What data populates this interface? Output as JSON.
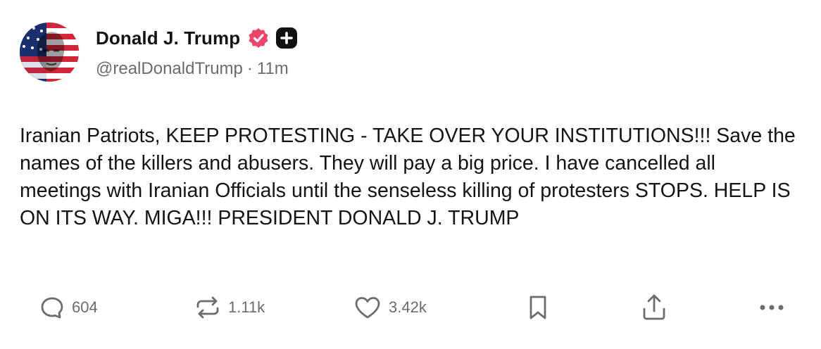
{
  "author": {
    "display_name": "Donald J. Trump",
    "handle": "@realDonaldTrump",
    "separator": "·",
    "time_ago": "11m",
    "avatar_alt": "Donald J. Trump profile photo",
    "verified_icon": "verified-badge-icon",
    "verified_color": "#f0436a",
    "plus_icon": "plus-badge-icon"
  },
  "post": {
    "text": "Iranian Patriots, KEEP PROTESTING - TAKE OVER YOUR INSTITUTIONS!!! Save the names of the killers and abusers. They will pay a big price. I have cancelled all meetings with Iranian Officials until the senseless killing of protesters STOPS. HELP IS ON ITS WAY. MIGA!!! PRESIDENT DONALD J. TRUMP"
  },
  "actions": {
    "reply": {
      "icon": "comment-icon",
      "count": "604"
    },
    "repost": {
      "icon": "repost-icon",
      "count": "1.11k"
    },
    "like": {
      "icon": "heart-icon",
      "count": "3.42k"
    },
    "bookmark": {
      "icon": "bookmark-icon"
    },
    "share": {
      "icon": "share-icon"
    },
    "more": {
      "icon": "more-icon"
    }
  },
  "colors": {
    "text": "#141414",
    "muted": "#6b6b70",
    "icon": "#6b6b70",
    "background": "#ffffff"
  }
}
